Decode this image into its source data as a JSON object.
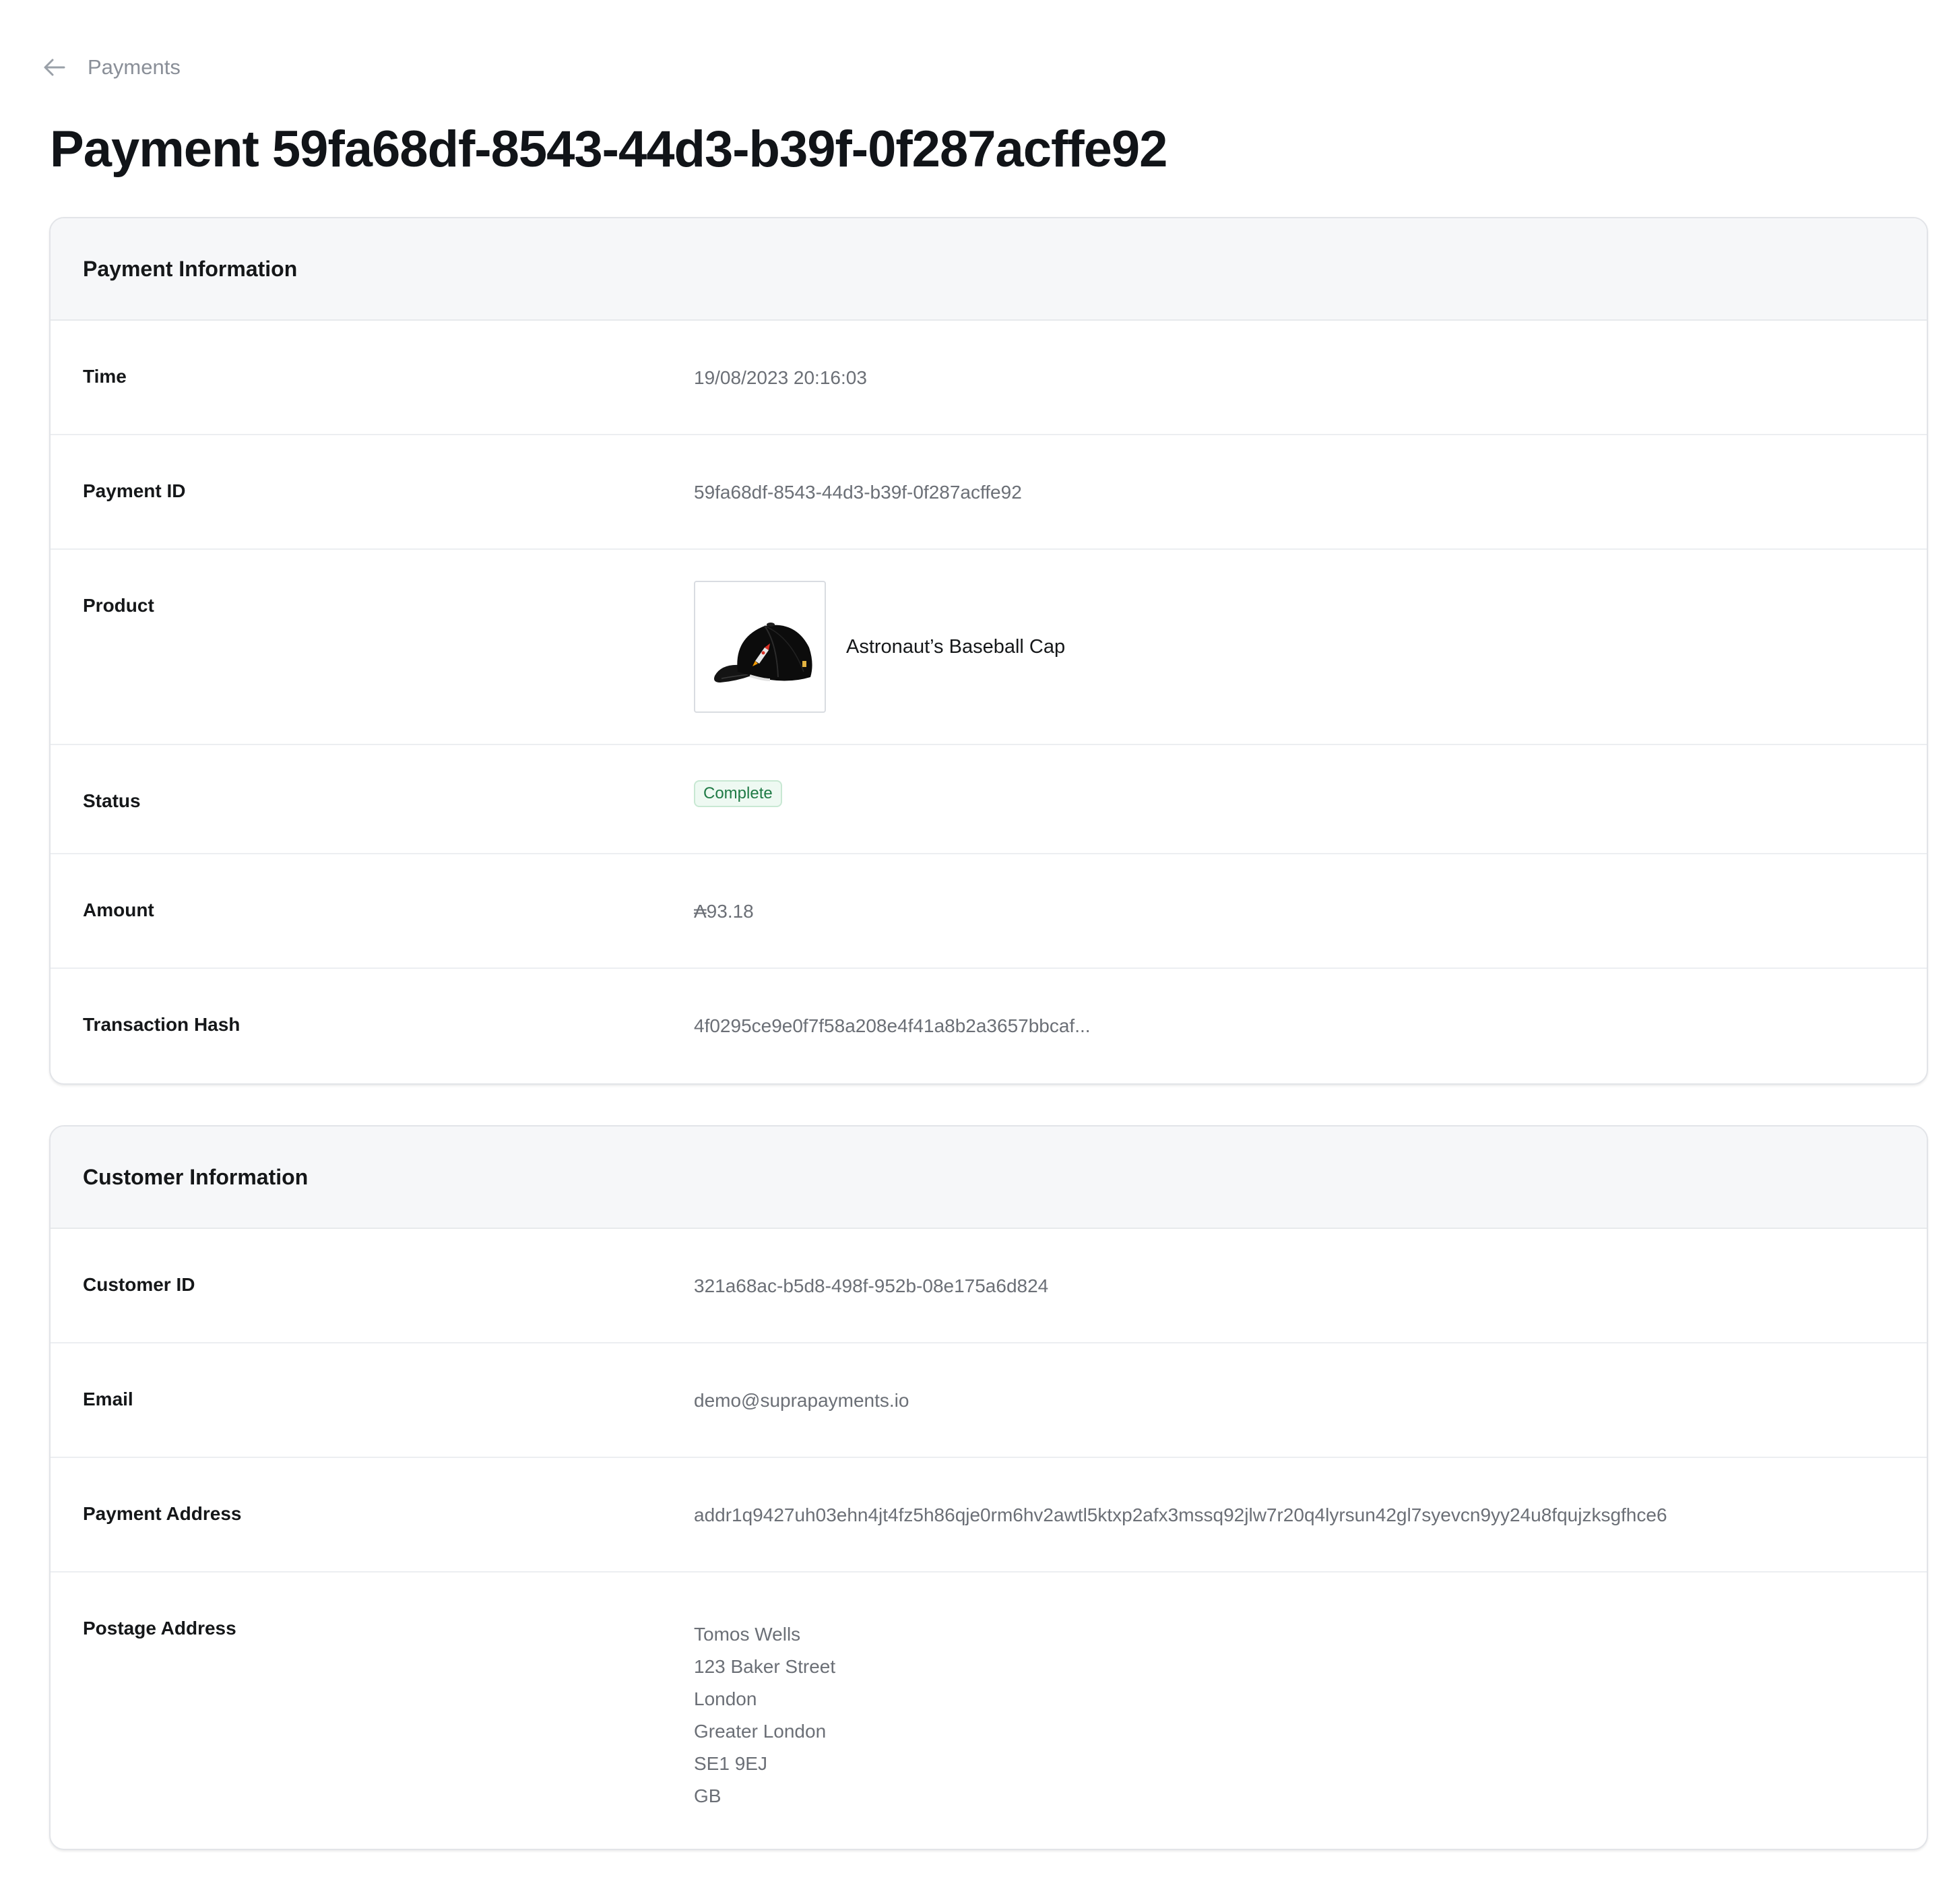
{
  "nav": {
    "back_label": "Payments"
  },
  "page": {
    "title": "Payment 59fa68df-8543-44d3-b39f-0f287acffe92"
  },
  "payment_info": {
    "header": "Payment Information",
    "time_label": "Time",
    "time_value": "19/08/2023 20:16:03",
    "payment_id_label": "Payment ID",
    "payment_id_value": "59fa68df-8543-44d3-b39f-0f287acffe92",
    "product_label": "Product",
    "product_name": "Astronaut’s Baseball Cap",
    "status_label": "Status",
    "status_value": "Complete",
    "amount_label": "Amount",
    "amount_value": "₳93.18",
    "tx_hash_label": "Transaction Hash",
    "tx_hash_value": "4f0295ce9e0f7f58a208e4f41a8b2a3657bbcaf..."
  },
  "customer_info": {
    "header": "Customer Information",
    "customer_id_label": "Customer ID",
    "customer_id_value": "321a68ac-b5d8-498f-952b-08e175a6d824",
    "email_label": "Email",
    "email_value": "demo@suprapayments.io",
    "payment_address_label": "Payment Address",
    "payment_address_value": "addr1q9427uh03ehn4jt4fz5h86qje0rm6hv2awtl5ktxp2afx3mssq92jlw7r20q4lyrsun42gl7syevcn9yy24u8fqujzksgfhce6",
    "postage_address_label": "Postage Address",
    "postage_address_lines": [
      "Tomos Wells",
      "123 Baker Street",
      "London",
      "Greater London",
      "SE1 9EJ",
      "GB"
    ]
  },
  "colors": {
    "status_complete_text": "#1f7a45",
    "status_complete_bg": "#eef9f2",
    "card_header_bg": "#f6f7f9"
  },
  "icons": {
    "back": "arrow-left-icon"
  }
}
